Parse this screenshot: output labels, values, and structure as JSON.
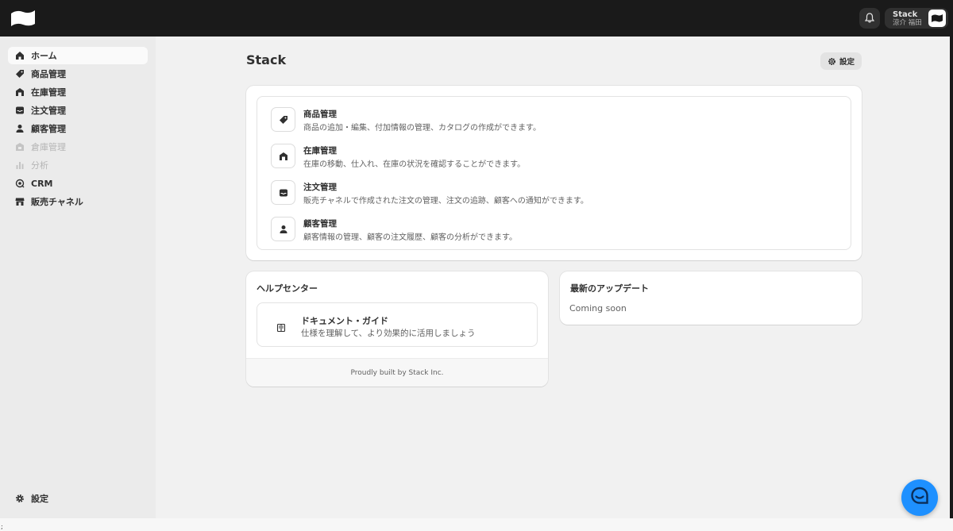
{
  "header": {
    "org_name": "Stack",
    "user_name": "涼介 福田",
    "logo_icon": "stack-logo-icon",
    "notification_icon": "bell-icon"
  },
  "sidebar": {
    "items": [
      {
        "label": "ホーム",
        "icon": "home-icon",
        "active": true,
        "disabled": false
      },
      {
        "label": "商品管理",
        "icon": "tag-icon",
        "active": false,
        "disabled": false
      },
      {
        "label": "在庫管理",
        "icon": "warehouse-icon",
        "active": false,
        "disabled": false
      },
      {
        "label": "注文管理",
        "icon": "inbox-icon",
        "active": false,
        "disabled": false
      },
      {
        "label": "顧客管理",
        "icon": "person-icon",
        "active": false,
        "disabled": false
      },
      {
        "label": "倉庫管理",
        "icon": "lock-box-icon",
        "active": false,
        "disabled": true
      },
      {
        "label": "分析",
        "icon": "bar-chart-icon",
        "active": false,
        "disabled": true
      },
      {
        "label": "CRM",
        "icon": "crm-icon",
        "active": false,
        "disabled": false
      },
      {
        "label": "販売チャネル",
        "icon": "store-icon",
        "active": false,
        "disabled": false
      }
    ],
    "settings_label": "設定"
  },
  "main": {
    "title": "Stack",
    "settings_button": "設定",
    "features": [
      {
        "title": "商品管理",
        "desc": "商品の追加・編集、付加情報の管理、カタログの作成ができます。",
        "icon": "tag-icon"
      },
      {
        "title": "在庫管理",
        "desc": "在庫の移動、仕入れ、在庫の状況を確認することができます。",
        "icon": "warehouse-icon"
      },
      {
        "title": "注文管理",
        "desc": "販売チャネルで作成された注文の管理、注文の追跡、顧客への通知ができます。",
        "icon": "inbox-icon"
      },
      {
        "title": "顧客管理",
        "desc": "顧客情報の管理、顧客の注文履歴、顧客の分析ができます。",
        "icon": "person-icon"
      }
    ],
    "help": {
      "heading": "ヘルプセンター",
      "doc_title": "ドキュメント・ガイド",
      "doc_desc": "仕様を理解して、より効果的に活用しましょう",
      "footer": "Proudly built by Stack Inc."
    },
    "updates": {
      "heading": "最新のアップデート",
      "text": "Coming soon"
    }
  },
  "misc": {
    "corner_mark": ";"
  }
}
